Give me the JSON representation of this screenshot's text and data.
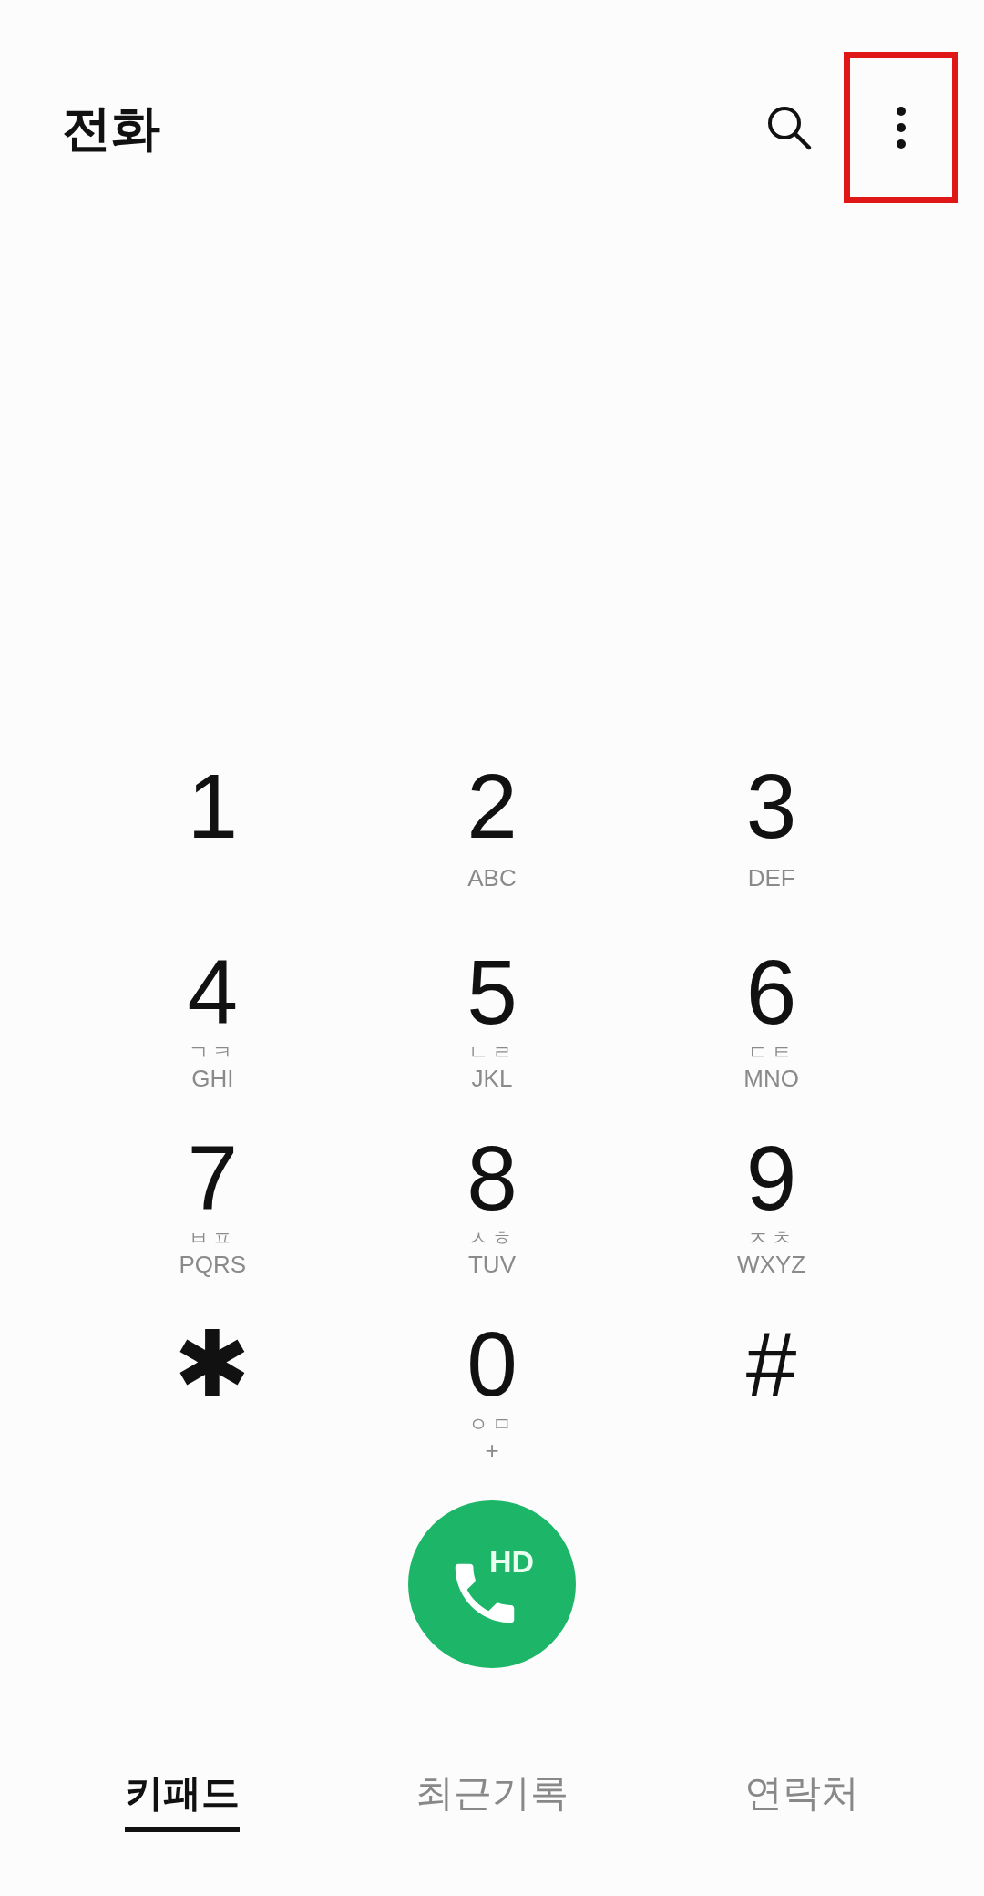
{
  "header": {
    "title": "전화",
    "menu_button": {
      "highlighted": true
    }
  },
  "keypad": [
    {
      "digit": "1"
    },
    {
      "digit": "2",
      "letters": "ABC"
    },
    {
      "digit": "3",
      "letters": "DEF"
    },
    {
      "digit": "4",
      "hangul": "ㄱㅋ",
      "letters": "GHI"
    },
    {
      "digit": "5",
      "hangul": "ㄴㄹ",
      "letters": "JKL"
    },
    {
      "digit": "6",
      "hangul": "ㄷㅌ",
      "letters": "MNO"
    },
    {
      "digit": "7",
      "hangul": "ㅂㅍ",
      "letters": "PQRS"
    },
    {
      "digit": "8",
      "hangul": "ㅅㅎ",
      "letters": "TUV"
    },
    {
      "digit": "9",
      "hangul": "ㅈㅊ",
      "letters": "WXYZ"
    },
    {
      "digit": "✱"
    },
    {
      "digit": "0",
      "hangul": "ㅇㅁ",
      "letters": "+"
    },
    {
      "digit": "#"
    }
  ],
  "call_button": {
    "badge": "HD"
  },
  "tabs": [
    {
      "label": "키패드",
      "selected": true
    },
    {
      "label": "최근기록",
      "selected": false
    },
    {
      "label": "연락처",
      "selected": false
    }
  ]
}
